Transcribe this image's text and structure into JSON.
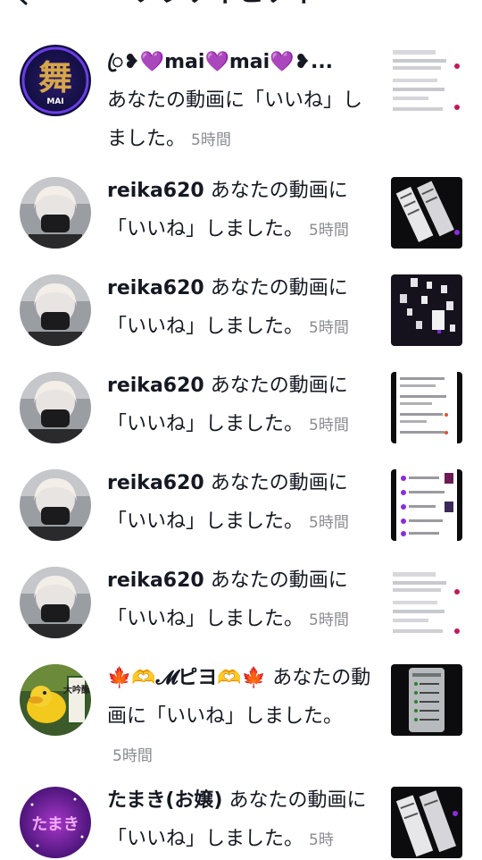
{
  "header": {
    "title": "アクティビティ",
    "back_icon": "chevron-left-icon"
  },
  "notifications": [
    {
      "username": "ꦿ❥💜mai💜mai💜❥...",
      "action": "あなたの動画に「いいね」しました。",
      "time": "5時間",
      "avatar_kanji": "舞",
      "avatar_sub": "MAI"
    },
    {
      "username": "reika620",
      "action": "あなたの動画に「いいね」しました。",
      "time": "5時間"
    },
    {
      "username": "reika620",
      "action": "あなたの動画に「いいね」しました。",
      "time": "5時間"
    },
    {
      "username": "reika620",
      "action": "あなたの動画に「いいね」しました。",
      "time": "5時間"
    },
    {
      "username": "reika620",
      "action": "あなたの動画に「いいね」しました。",
      "time": "5時間"
    },
    {
      "username": "reika620",
      "action": "あなたの動画に「いいね」しました。",
      "time": "5時間"
    },
    {
      "username": "🍁🫶𝓜ピヨ🫶🍁",
      "action": "あなたの動画に「いいね」しました。",
      "time": "5時間",
      "avatar_sign": "大吟醸"
    },
    {
      "username": "たまき(お嬢)",
      "action": "あなたの動画に「いいね」しました。",
      "time": "5時",
      "avatar_kanji": "たまき"
    }
  ],
  "colors": {
    "text": "#161823",
    "time": "#8a8b91",
    "accent": "#8a2be2"
  }
}
